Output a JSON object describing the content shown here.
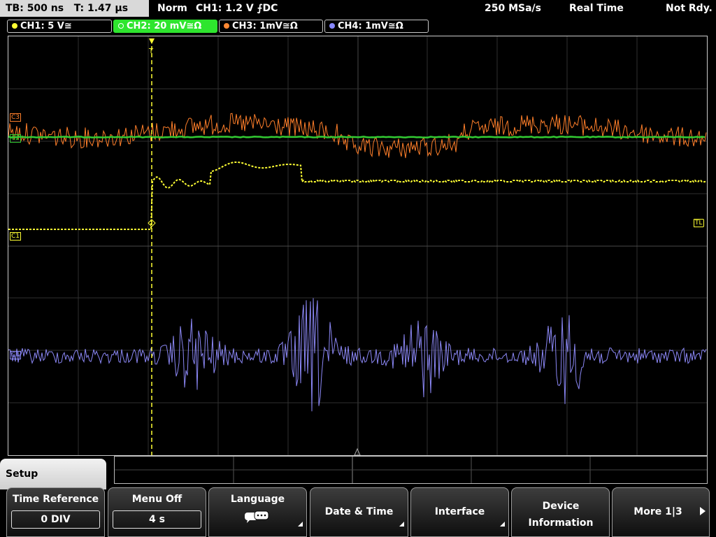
{
  "status": {
    "timebase": "TB: 500 ns",
    "trigger_time": "T: 1.47 µs",
    "mode": "Norm",
    "trigger": "CH1: 1.2 V ⨍DC",
    "sample_rate": "250 MSa/s",
    "acq_mode": "Real Time",
    "state": "Not Rdy."
  },
  "channels": [
    {
      "label": "CH1: 5 V≅",
      "color": "#ffff33",
      "active": false
    },
    {
      "label": "CH2: 20 mV≅Ω",
      "color": "#33cc33",
      "active": true
    },
    {
      "label": "CH3: 1mV≅Ω",
      "color": "#ff8833",
      "active": false
    },
    {
      "label": "CH4: 1mV≅Ω",
      "color": "#8888ff",
      "active": false
    }
  ],
  "markers": {
    "ch1": "C1",
    "ch2": "C2",
    "ch3": "C3",
    "ch4": "C4",
    "trigger_level": "TL",
    "trigger_pos": "T"
  },
  "menu": {
    "title": "Setup",
    "softkeys": [
      {
        "label": "Time Reference",
        "value": "0 DIV"
      },
      {
        "label": "Menu Off",
        "value": "4 s"
      },
      {
        "label": "Language",
        "icon": "speech-bubble-icon"
      },
      {
        "label": "Date & Time"
      },
      {
        "label": "Interface"
      },
      {
        "label": "Device Information"
      },
      {
        "label": "More 1|3",
        "icon": "arrow-right-icon"
      }
    ]
  },
  "colors": {
    "ch1": "#ffff33",
    "ch2": "#33cc33",
    "ch3": "#ff7f2a",
    "ch4": "#8b87f5",
    "grid": "#3a3a3a"
  }
}
